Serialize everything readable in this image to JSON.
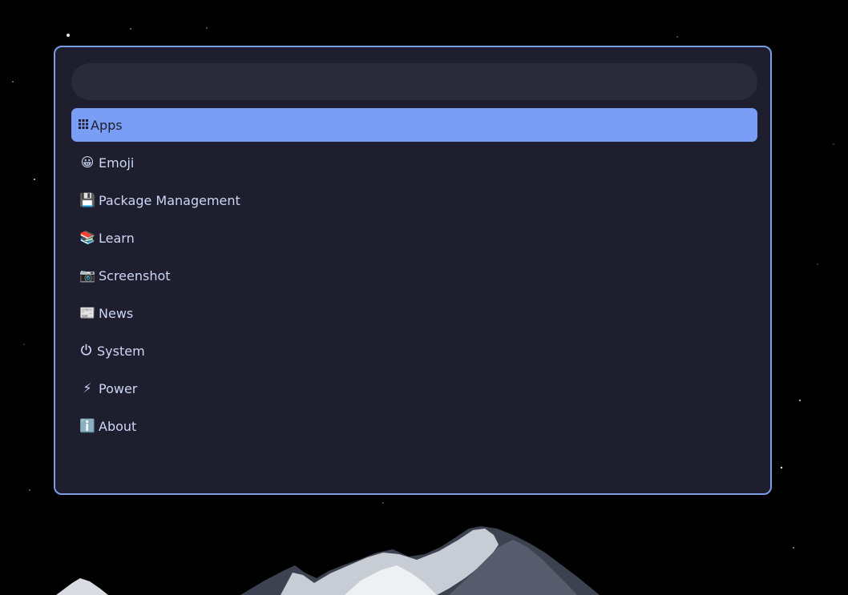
{
  "launcher": {
    "search": {
      "value": "",
      "placeholder": ""
    },
    "items": [
      {
        "label": "Apps",
        "icon": "apps-grid-icon",
        "glyph": "⠿",
        "selected": true
      },
      {
        "label": "Emoji",
        "icon": "grinning-face-icon",
        "glyph": "😀",
        "selected": false
      },
      {
        "label": "Package Management",
        "icon": "floppy-disk-icon",
        "glyph": "💾",
        "selected": false
      },
      {
        "label": "Learn",
        "icon": "books-icon",
        "glyph": "📚",
        "selected": false
      },
      {
        "label": "Screenshot",
        "icon": "camera-icon",
        "glyph": "📷",
        "selected": false
      },
      {
        "label": "News",
        "icon": "newspaper-icon",
        "glyph": "📰",
        "selected": false
      },
      {
        "label": "System",
        "icon": "power-symbol-icon",
        "glyph": "⏻",
        "selected": false
      },
      {
        "label": "Power",
        "icon": "lightning-icon",
        "glyph": "⚡",
        "selected": false
      },
      {
        "label": "About",
        "icon": "info-icon",
        "glyph": "ℹ️",
        "selected": false
      }
    ]
  },
  "colors": {
    "background": "#000000",
    "panel": "#1e1e2e",
    "panel_border": "#7a9de6",
    "search_bg": "#292a3a",
    "selected_bg": "#7a9ef6",
    "text": "#cdd6f4",
    "selected_text": "#1e1e2e"
  }
}
